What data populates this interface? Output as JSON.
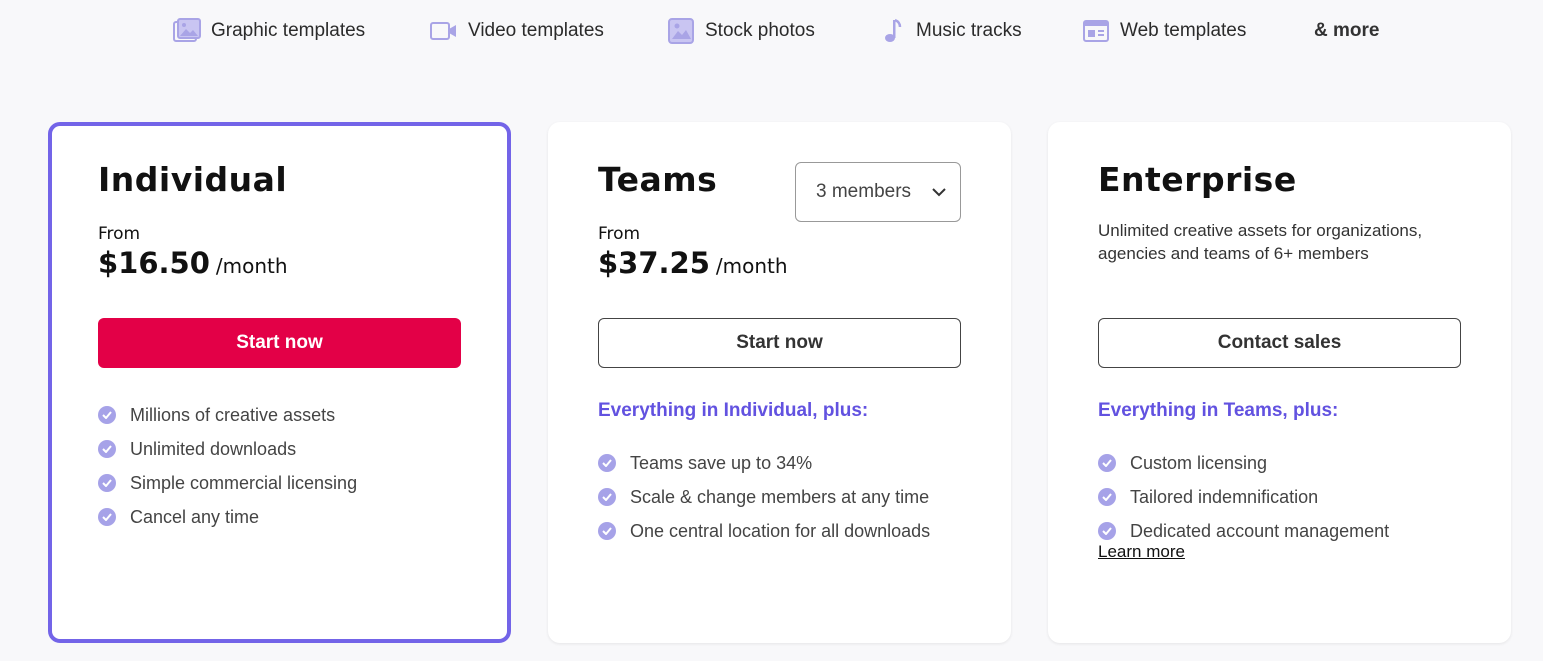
{
  "nav": {
    "items": [
      {
        "label": "Graphic templates",
        "icon": "image-icon"
      },
      {
        "label": "Video templates",
        "icon": "video-icon"
      },
      {
        "label": "Stock photos",
        "icon": "photo-icon"
      },
      {
        "label": "Music tracks",
        "icon": "music-note-icon"
      },
      {
        "label": "Web templates",
        "icon": "web-template-icon"
      }
    ],
    "more_label": "& more"
  },
  "colors": {
    "accent": "#6252e0",
    "primary_cta": "#e30047",
    "check": "#a6a2e8",
    "selected_border": "#7364e8",
    "nav_icon": "#a9a4e6"
  },
  "plans": {
    "individual": {
      "title": "Individual",
      "from_label": "From",
      "price": "$16.50",
      "period": "/month",
      "cta_label": "Start now",
      "features": [
        "Millions of creative assets",
        "Unlimited downloads",
        "Simple commercial licensing",
        "Cancel any time"
      ]
    },
    "teams": {
      "title": "Teams",
      "members_select": "3 members",
      "from_label": "From",
      "price": "$37.25",
      "period": "/month",
      "cta_label": "Start now",
      "plus_heading": "Everything in Individual, plus:",
      "features": [
        "Teams save up to 34%",
        "Scale & change members at any time",
        "One central location for all downloads"
      ]
    },
    "enterprise": {
      "title": "Enterprise",
      "description": "Unlimited creative assets for organizations, agencies and teams of 6+ members",
      "cta_label": "Contact sales",
      "plus_heading": "Everything in Teams, plus:",
      "features": [
        "Custom licensing",
        "Tailored indemnification",
        "Dedicated account management"
      ],
      "learn_more": "Learn more"
    }
  }
}
